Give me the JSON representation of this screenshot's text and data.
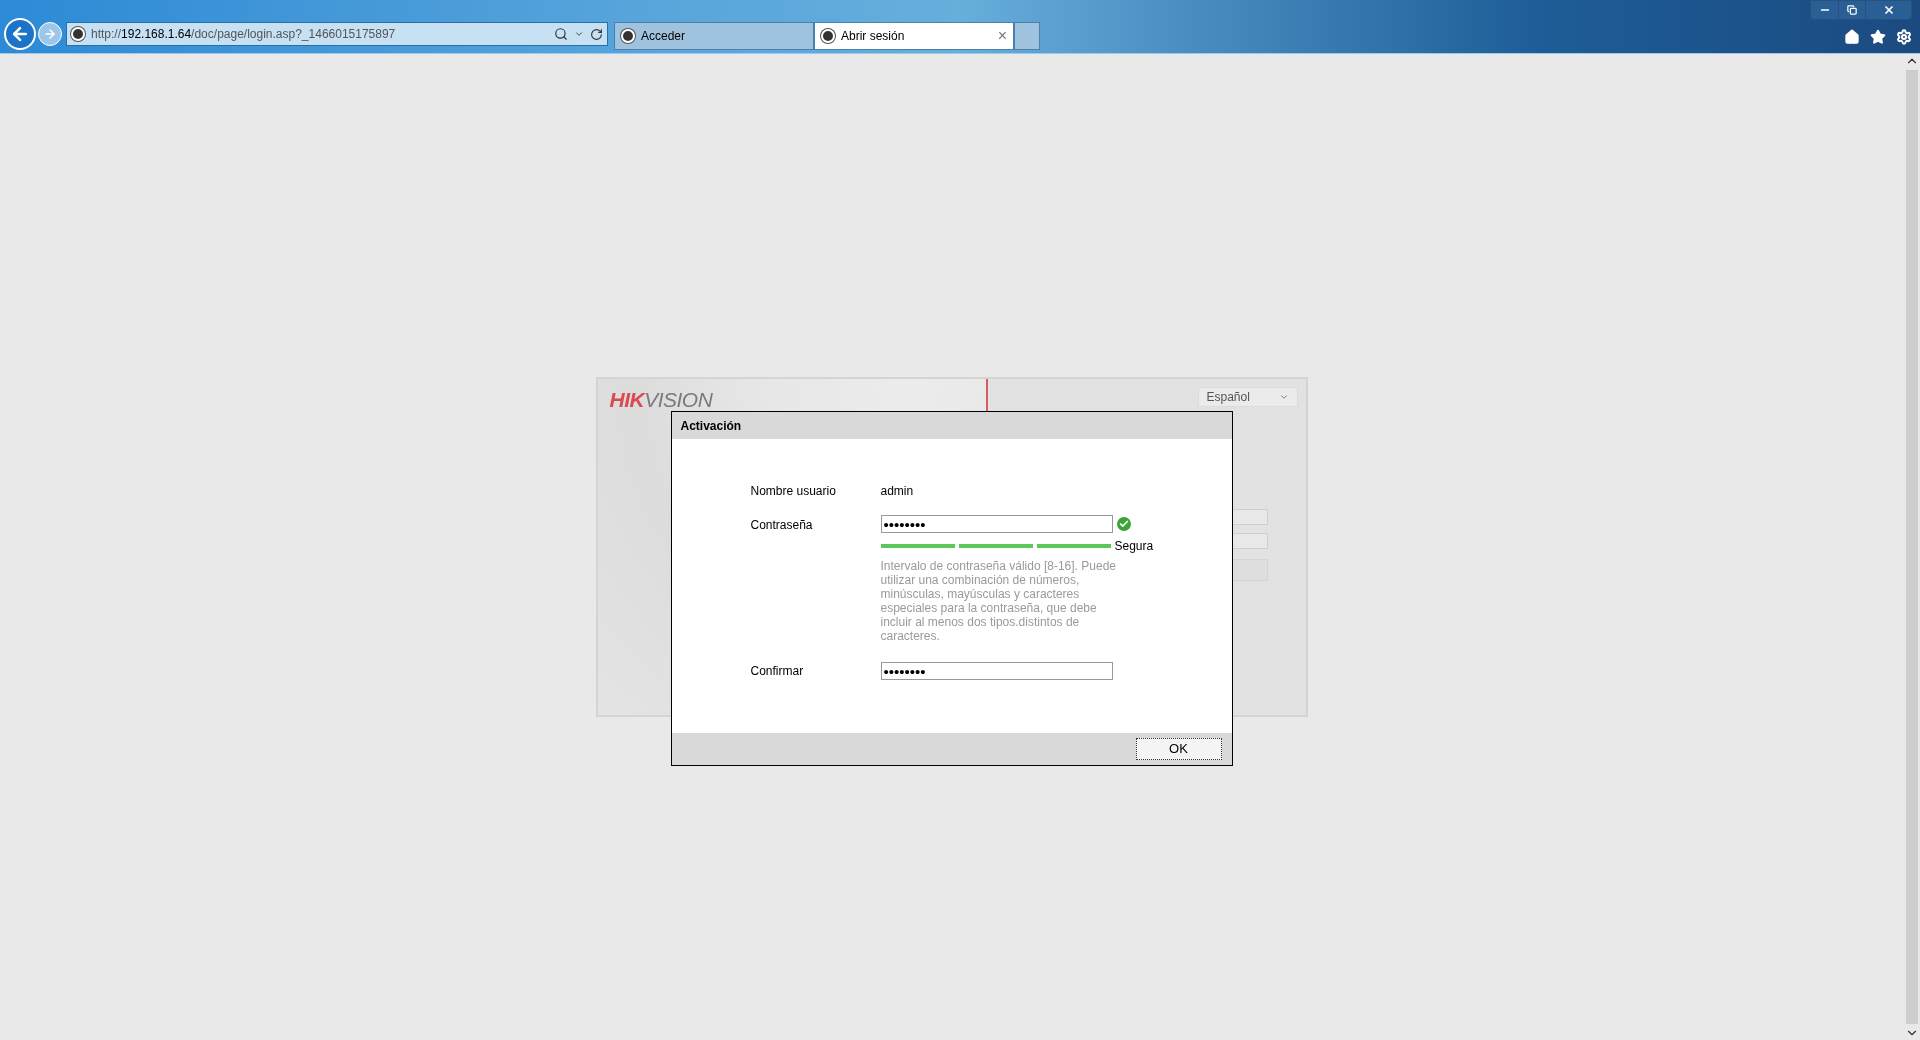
{
  "browser": {
    "url": {
      "scheme": "http://",
      "host": "192.168.1.64",
      "path": "/doc/page/login.asp?_1466015175897"
    },
    "tabs": [
      {
        "label": "Acceder",
        "selected": false
      },
      {
        "label": "Abrir sesión",
        "selected": true,
        "close": "×"
      }
    ]
  },
  "login_panel": {
    "logo": {
      "accent": "HIK",
      "rest": "VISION"
    },
    "language": "Español"
  },
  "dialog": {
    "title": "Activación",
    "username": {
      "label": "Nombre usuario",
      "value": "admin"
    },
    "password": {
      "label": "Contraseña",
      "value": "••••••••",
      "valid": true
    },
    "strength": {
      "label": "Segura",
      "segments": [
        {
          "on": true
        },
        {
          "on": true
        },
        {
          "on": true
        }
      ]
    },
    "hint": "Intervalo de contraseña válido [8-16]. Puede utilizar una combinación de números, minúsculas, mayúsculas y caracteres especiales para la contraseña, que debe incluir al menos dos tipos.distintos de caracteres.",
    "confirm": {
      "label": "Confirmar",
      "value": "••••••••"
    },
    "ok": "OK"
  }
}
